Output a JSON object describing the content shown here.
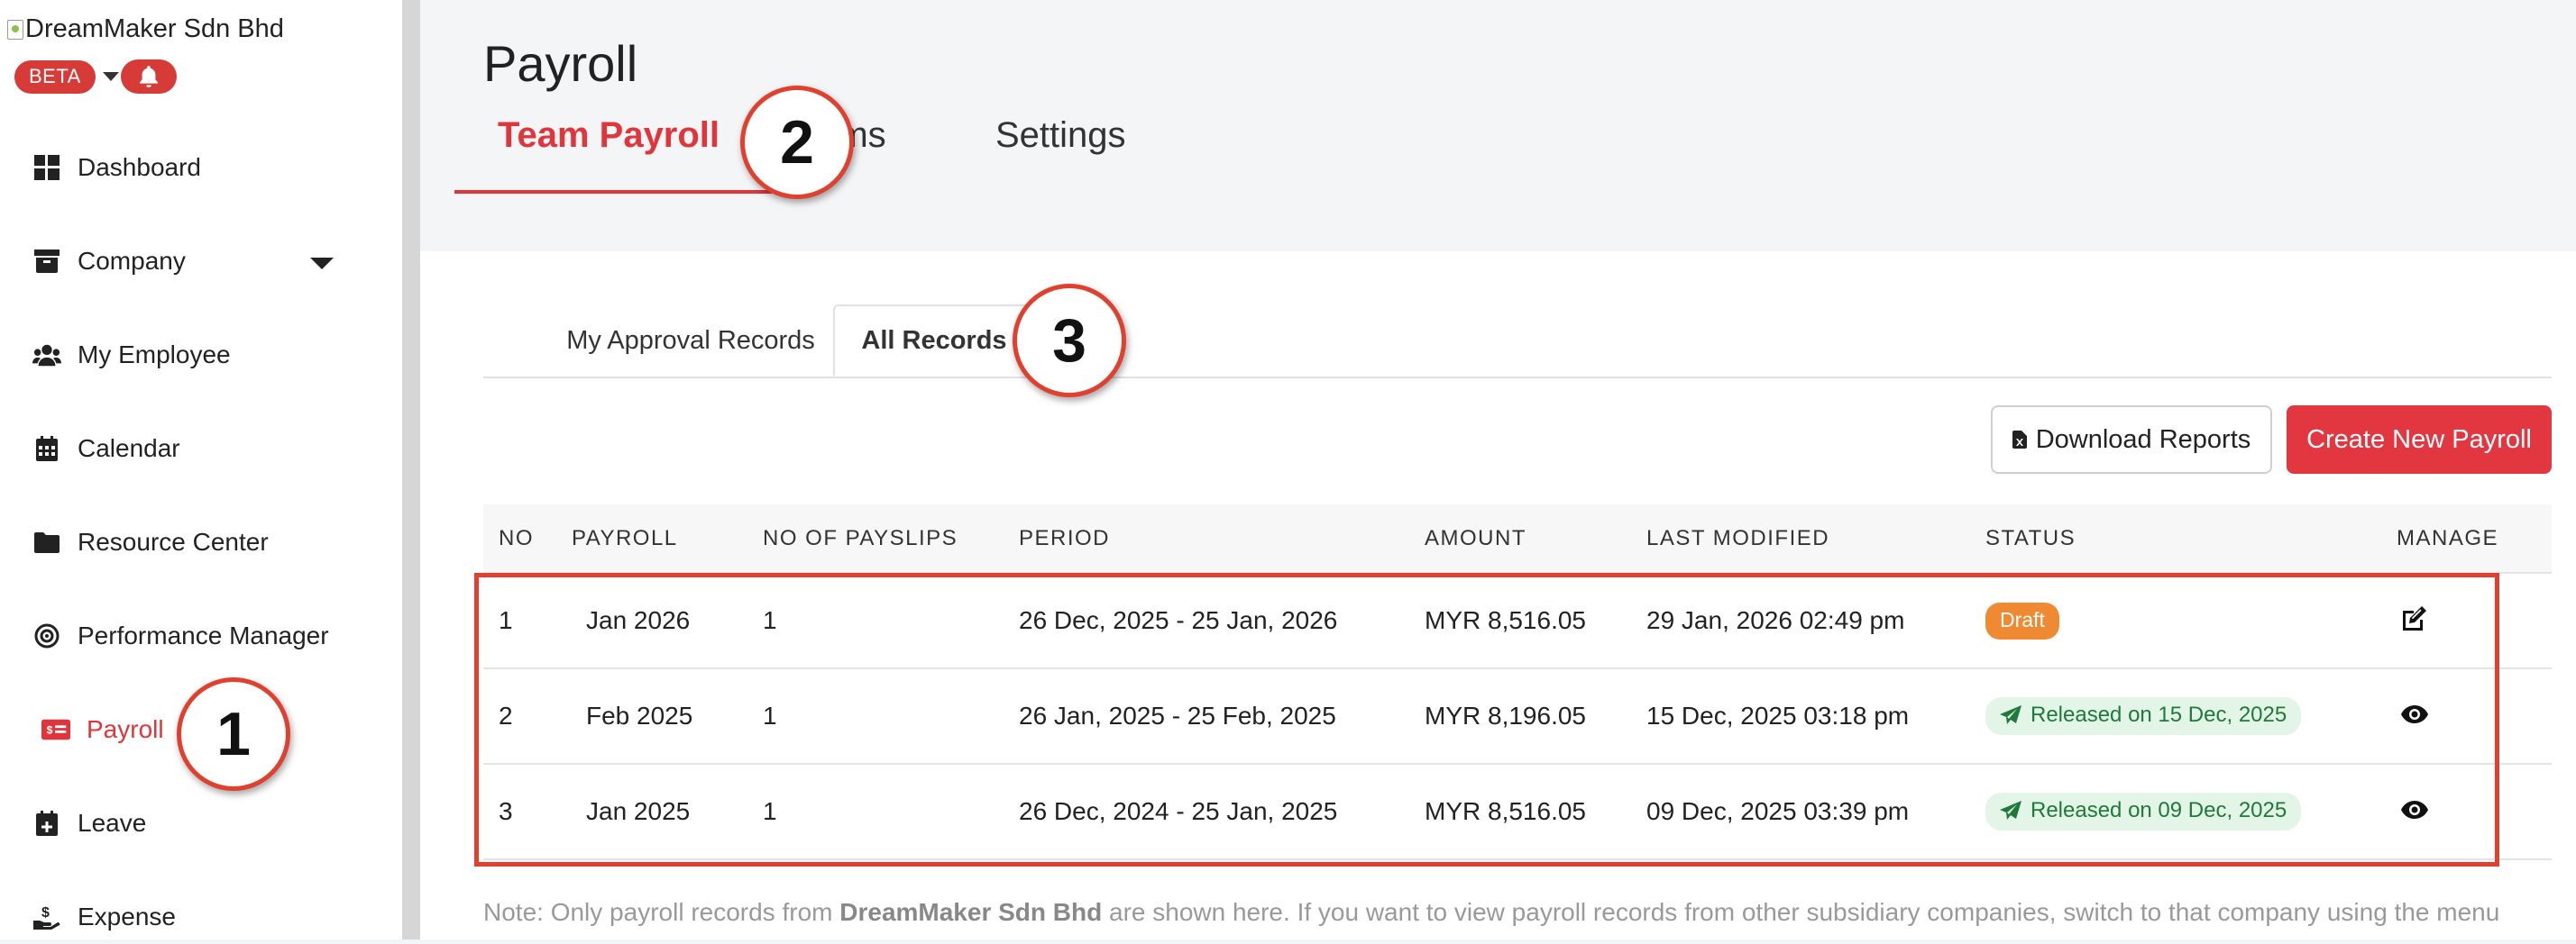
{
  "sidebar": {
    "company_logo_alt": "DreamMaker Sdn Bhd",
    "beta_label": "BETA",
    "items": [
      {
        "label": "Dashboard",
        "icon": "grid-icon"
      },
      {
        "label": "Company",
        "icon": "archive-icon"
      },
      {
        "label": "My Employee",
        "icon": "users-icon"
      },
      {
        "label": "Calendar",
        "icon": "calendar-icon"
      },
      {
        "label": "Resource Center",
        "icon": "folder-icon"
      },
      {
        "label": "Performance Manager",
        "icon": "target-icon"
      },
      {
        "label": "Payroll",
        "icon": "money-bill-icon",
        "active": true
      },
      {
        "label": "Leave",
        "icon": "calendar-plus-icon"
      },
      {
        "label": "Expense",
        "icon": "hand-dollar-icon"
      }
    ]
  },
  "page": {
    "title": "Payroll",
    "tabs": [
      {
        "label": "Team Payroll",
        "active": true
      },
      {
        "label": "tems"
      },
      {
        "label": "Settings"
      }
    ]
  },
  "records": {
    "subtabs": [
      {
        "label": "My Approval Records"
      },
      {
        "label": "All Records",
        "active": true
      }
    ],
    "download_label": "Download Reports",
    "create_label": "Create New Payroll",
    "columns": [
      "NO",
      "PAYROLL",
      "NO OF PAYSLIPS",
      "PERIOD",
      "AMOUNT",
      "LAST MODIFIED",
      "STATUS",
      "MANAGE"
    ],
    "rows": [
      {
        "no": "1",
        "payroll": "Jan 2026",
        "payslips": "1",
        "period": "26 Dec, 2025 - 25 Jan, 2026",
        "amount": "MYR 8,516.05",
        "modified": "29 Jan, 2026 02:49 pm",
        "status": "Draft",
        "status_type": "draft",
        "action_icon": "edit-icon"
      },
      {
        "no": "2",
        "payroll": "Feb 2025",
        "payslips": "1",
        "period": "26 Jan, 2025 - 25 Feb, 2025",
        "amount": "MYR 8,196.05",
        "modified": "15 Dec, 2025 03:18 pm",
        "status": "Released on 15 Dec, 2025",
        "status_type": "released",
        "action_icon": "eye-icon"
      },
      {
        "no": "3",
        "payroll": "Jan 2025",
        "payslips": "1",
        "period": "26 Dec, 2024 - 25 Jan, 2025",
        "amount": "MYR 8,516.05",
        "modified": "09 Dec, 2025 03:39 pm",
        "status": "Released on 09 Dec, 2025",
        "status_type": "released",
        "action_icon": "eye-icon"
      }
    ],
    "note_prefix": "Note: Only payroll records from ",
    "note_company": "DreamMaker Sdn Bhd",
    "note_suffix": " are shown here. If you want to view payroll records from other subsidiary companies, switch to that company using the menu"
  },
  "annotations": {
    "callouts": [
      "1",
      "2",
      "3"
    ]
  },
  "colors": {
    "accent": "#e0353b",
    "draft": "#ef8a32",
    "released_bg": "#e3f5e7",
    "released_text": "#1f7a3a",
    "annotation": "#e0402d"
  }
}
